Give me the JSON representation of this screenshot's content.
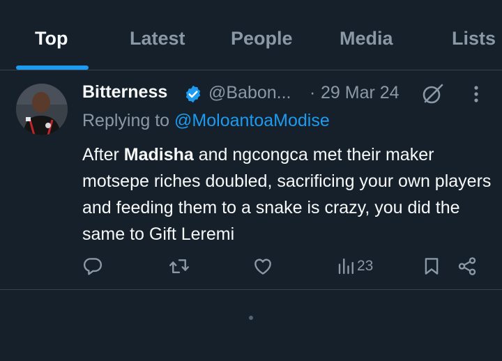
{
  "tabs": [
    {
      "label": "Top",
      "active": true
    },
    {
      "label": "Latest",
      "active": false
    },
    {
      "label": "People",
      "active": false
    },
    {
      "label": "Media",
      "active": false
    },
    {
      "label": "Lists",
      "active": false
    }
  ],
  "tweet": {
    "author_name": "Bitterness",
    "verified": true,
    "handle": "@Babon...",
    "separator": "·",
    "date": "29 Mar 24",
    "reply_prefix": "Replying to ",
    "reply_to": "@MoloantoaModise",
    "text_before": "After ",
    "text_bold": "Madisha",
    "text_after": " ngcongca met their maker motsepe riches doubled, sacrificing your own players and feeding them to a snake is crazy, you did the same to Gift Leremi",
    "text_connector": "and",
    "views": "23"
  },
  "icons": {
    "verified": "verified-badge-icon",
    "grok": "grok-icon",
    "more": "more-options-icon",
    "reply": "reply-icon",
    "retweet": "retweet-icon",
    "like": "like-icon",
    "views": "views-icon",
    "bookmark": "bookmark-icon",
    "share": "share-icon"
  },
  "colors": {
    "background": "#15202b",
    "accent": "#1d9bf0",
    "muted": "#8b98a5",
    "divider": "#38444d"
  }
}
